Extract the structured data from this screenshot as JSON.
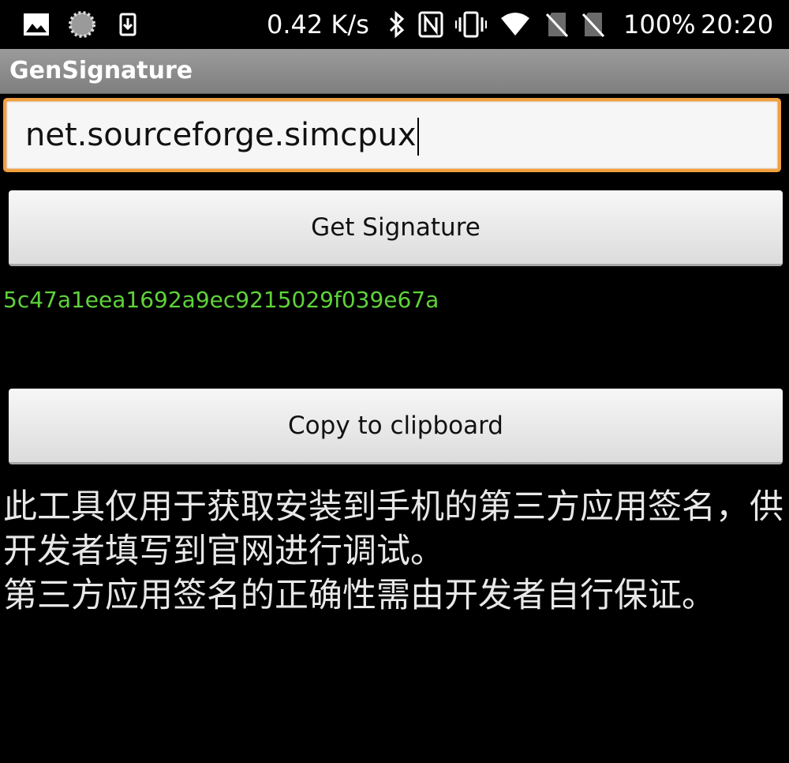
{
  "status_bar": {
    "net_speed": "0.42 K/s",
    "battery": "100%",
    "time": "20:20",
    "icons": [
      "image-icon",
      "loading-icon",
      "download-icon",
      "bluetooth-icon",
      "nfc-icon",
      "vibrate-icon",
      "wifi-icon",
      "no-sim-icon",
      "no-sim-icon"
    ]
  },
  "app_bar": {
    "title": "GenSignature"
  },
  "form": {
    "package_value": "net.sourceforge.simcpux",
    "get_signature_label": "Get Signature",
    "signature": "5c47a1eea1692a9ec9215029f039e67a",
    "copy_label": "Copy to clipboard"
  },
  "description": {
    "line1": "此工具仅用于获取安装到手机的第三方应用签名，供开发者填写到官网进行调试。",
    "line2": "第三方应用签名的正确性需由开发者自行保证。"
  },
  "colors": {
    "signature_text": "#5fd33a",
    "input_focus_border": "#f0a040",
    "background": "#000000"
  }
}
